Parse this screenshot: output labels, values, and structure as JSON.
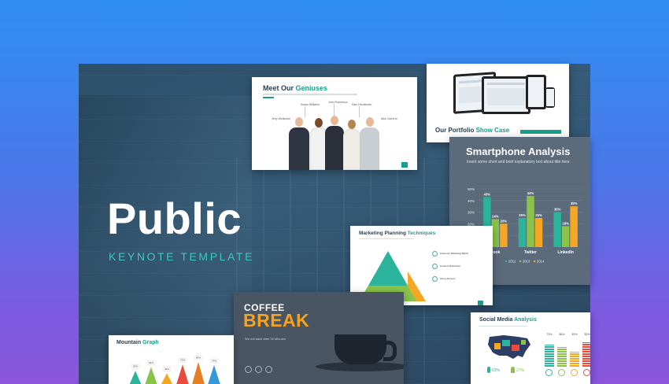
{
  "hero": {
    "title": "Public",
    "subtitle": "KEYNOTE TEMPLATE"
  },
  "team_slide": {
    "title_plain": "Meet Our ",
    "title_accent": "Geniuses",
    "names": [
      "Jerry Wolkchan",
      "Susan Williams",
      "John Robertson",
      "Sam Henderson",
      "Nick Carreror"
    ],
    "accent_color": "#1aa08a"
  },
  "portfolio_slide": {
    "title_plain": "Our Portfolio ",
    "title_accent": "Show Case"
  },
  "smartphone_slide": {
    "title": "Smartphone Analysis",
    "subtitle": "Insert some short and brief explanatory text about title here",
    "chart_data": {
      "type": "bar",
      "categories": [
        "book",
        "Twitter",
        "LinkedIn"
      ],
      "series": [
        {
          "name": "2012",
          "values": [
            43,
            25,
            30
          ],
          "color": "#2bb39c"
        },
        {
          "name": "2013",
          "values": [
            24,
            44,
            18
          ],
          "color": "#8bc34a"
        },
        {
          "name": "2014",
          "values": [
            20,
            25,
            35
          ],
          "color": "#f5a623"
        }
      ],
      "ylim": [
        0,
        50
      ],
      "yticks": [
        "50%",
        "40%",
        "30%",
        "20%",
        "10%"
      ],
      "data_labels": [
        [
          "43%",
          "24%",
          "20%"
        ],
        [
          "25%",
          "44%",
          "25%"
        ],
        [
          "30%",
          "18%",
          "35%"
        ]
      ],
      "legend": [
        "2012",
        "2013",
        "2014"
      ]
    }
  },
  "marketing_slide": {
    "title_plain": "Marketing Planning ",
    "title_accent": "Techniques",
    "items": [
      "Customer Marketing Matrix",
      "Content Distribution",
      "Using Surveys"
    ]
  },
  "coffee_slide": {
    "line1": "COFFEE",
    "line2": "BREAK",
    "note": "We will back after 30 Minutes"
  },
  "mountain_slide": {
    "title_plain": "Mountain ",
    "title_accent": "Graph",
    "peaks": [
      {
        "label": "52%",
        "color": "#2bb39c"
      },
      {
        "label": "64%",
        "color": "#8bc34a"
      },
      {
        "label": "44%",
        "color": "#f5a623"
      },
      {
        "label": "72%",
        "color": "#e74c3c"
      },
      {
        "label": "80%",
        "color": "#e67e22"
      },
      {
        "label": "70%",
        "color": "#3498db"
      }
    ]
  },
  "social_slide": {
    "title_plain": "Social Media ",
    "title_accent": "Analysis",
    "stats": [
      "63%",
      "27%"
    ],
    "bar_labels": [
      "73%",
      "66%",
      "49%",
      "82%"
    ]
  }
}
